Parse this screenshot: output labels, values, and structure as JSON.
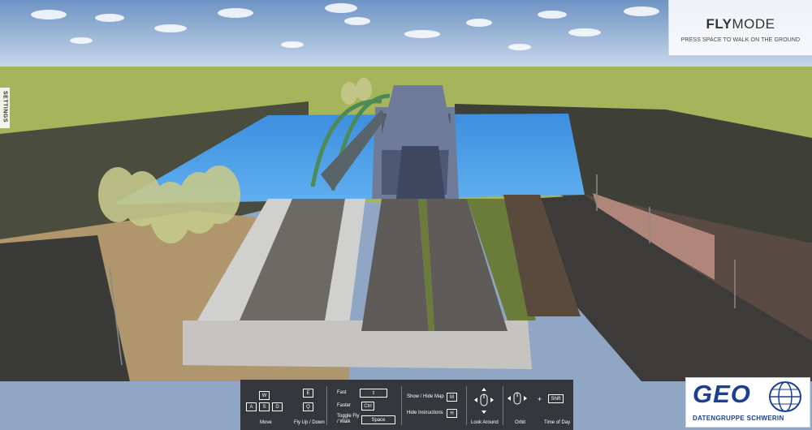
{
  "fly_mode": {
    "title_bold": "FLY",
    "title_light": "MODE",
    "hint": "PRESS SPACE TO WALK ON THE GROUND"
  },
  "settings_tab": {
    "label": "SETTINGS"
  },
  "controls": {
    "move": {
      "keys": [
        "W",
        "A",
        "S",
        "D"
      ],
      "label": "Move"
    },
    "fly": {
      "keys": [
        "E",
        "Q"
      ],
      "label": "Fly Up / Down"
    },
    "speed": {
      "fast_label": "Fast",
      "fast_key": "⇧",
      "faster_label": "Faster",
      "faster_key": "Ctrl",
      "toggle_label": "Toggle Fly / Walk",
      "toggle_key": "Space"
    },
    "map": {
      "show_hide_label": "Show / Hide Map",
      "show_hide_key": "M",
      "instructions_label": "Hide Instructions",
      "instructions_key": "H"
    },
    "look": {
      "label": "Look Around"
    },
    "orbit": {
      "label": "Orbit",
      "plus": "+"
    },
    "time": {
      "key": "Shift",
      "label": "Time of Day"
    }
  },
  "logo": {
    "text": "GEO",
    "subtitle": "DATENGRUPPE SCHWERIN"
  }
}
